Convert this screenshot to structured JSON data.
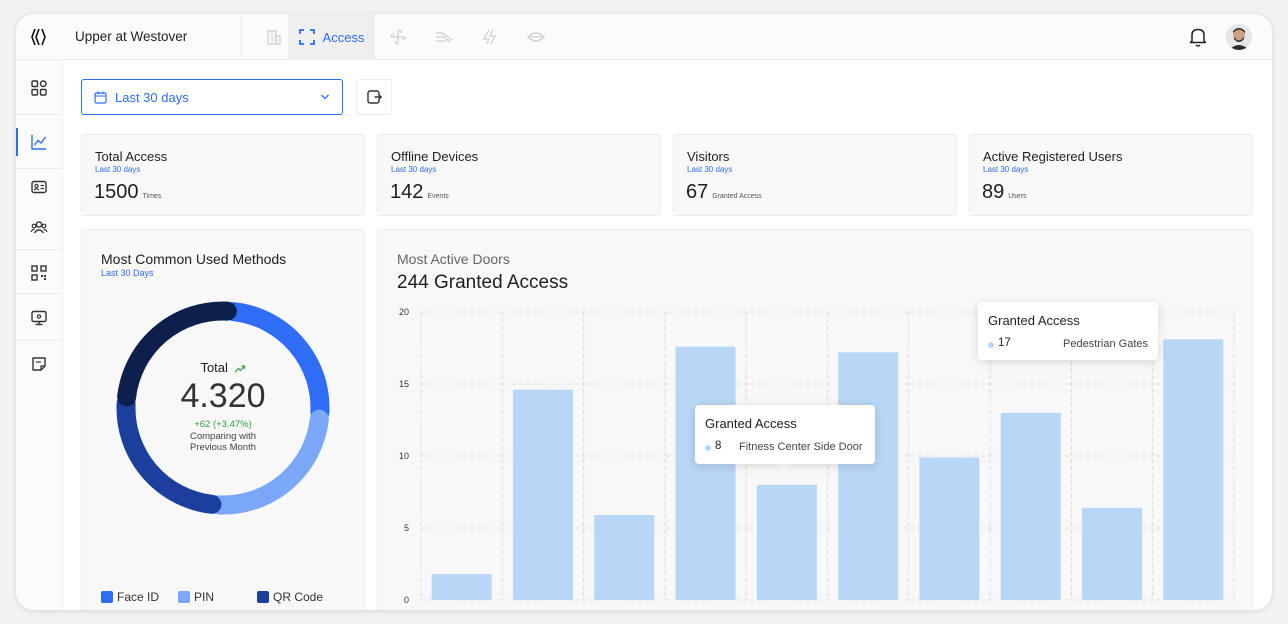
{
  "app": {
    "site_name": "Upper at Westover",
    "active_tab_label": "Access"
  },
  "top_tabs": [
    {
      "icon": "building-icon",
      "active": false
    },
    {
      "icon": "scan-frame-icon",
      "label": "Access",
      "active": true
    },
    {
      "icon": "fan-icon",
      "active": false
    },
    {
      "icon": "wind-icon",
      "active": false
    },
    {
      "icon": "bolt-icon",
      "active": false
    },
    {
      "icon": "eye-icon",
      "active": false
    }
  ],
  "sidebar": {
    "items": [
      {
        "icon": "dashboard-grid-icon",
        "active": false
      },
      {
        "icon": "analytics-chart-icon",
        "active": true
      },
      {
        "icon": "id-card-icon",
        "active": false
      },
      {
        "icon": "users-icon",
        "active": false
      },
      {
        "icon": "qr-code-icon",
        "active": false
      },
      {
        "icon": "monitor-icon",
        "active": false
      },
      {
        "icon": "note-icon",
        "active": false
      }
    ]
  },
  "filters": {
    "date_range": "Last 30 days",
    "export_icon": "export-icon"
  },
  "stats": [
    {
      "title": "Total Access",
      "period": "Last 30 days",
      "value": "1500",
      "unit": "Times"
    },
    {
      "title": "Offline Devices",
      "period": "Last 30 days",
      "value": "142",
      "unit": "Events"
    },
    {
      "title": "Visitors",
      "period": "Last 30 days",
      "value": "67",
      "unit": "Granted Access"
    },
    {
      "title": "Active Registered Users",
      "period": "Last 30 days",
      "value": "89",
      "unit": "Users"
    }
  ],
  "methods": {
    "title": "Most Common Used Methods",
    "period": "Last 30 Days",
    "total_label": "Total",
    "total_value": "4.320",
    "change": "+62 (+3.47%)",
    "comparison_line1": "Comparing with",
    "comparison_line2": "Previous Month",
    "segments": [
      {
        "label": "Face ID",
        "color": "#2f6df6",
        "share": 0.2
      },
      {
        "label": "PIN",
        "color": "#7aa7f8",
        "share": 0.2
      },
      {
        "label": "QR Code",
        "color": "#1c3f9e",
        "share": 0.2
      },
      {
        "label": "",
        "color": "#0c1f4d",
        "share": 0.2
      }
    ],
    "legend": [
      {
        "label": "Face ID",
        "color": "#2f6df6"
      },
      {
        "label": "PIN",
        "color": "#7aa7f8"
      },
      {
        "label": "QR Code",
        "color": "#1c3f9e"
      }
    ]
  },
  "doors": {
    "subtitle": "Most Active Doors",
    "title": "244 Granted Access",
    "tooltips": [
      {
        "title": "Granted Access",
        "value": "8",
        "door": "Fitness Center Side Door"
      },
      {
        "title": "Granted Access",
        "value": "17",
        "door": "Pedestrian Gates"
      }
    ]
  },
  "chart_data": {
    "type": "bar",
    "title": "244 Granted Access",
    "xlabel": "",
    "ylabel": "",
    "ylim": [
      0,
      20
    ],
    "y_ticks": [
      "0",
      "5",
      "10",
      "15",
      "20"
    ],
    "values": [
      1.8,
      14.6,
      5.9,
      17.6,
      8,
      17.2,
      9.9,
      13,
      6.4,
      18.1
    ],
    "bar_color": "#b8d6f5",
    "grid": true
  }
}
